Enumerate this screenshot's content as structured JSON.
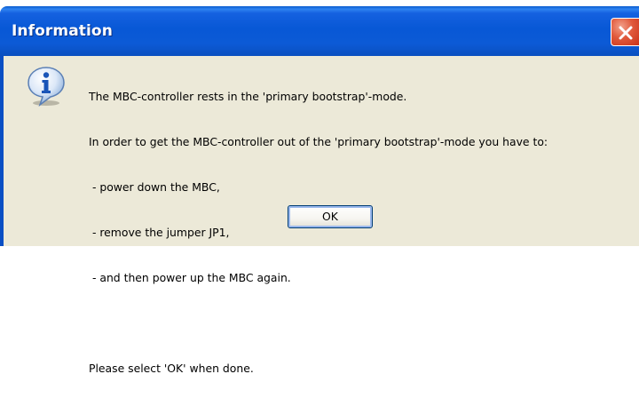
{
  "window": {
    "title": "Information",
    "icon": "information-icon",
    "close_icon": "close-icon"
  },
  "message": {
    "lines": [
      "The MBC-controller rests in the 'primary bootstrap'-mode.",
      "In order to get the MBC-controller out of the 'primary bootstrap'-mode you have to:",
      " - power down the MBC,",
      " - remove the jumper JP1,",
      " - and then power up the MBC again.",
      "",
      "Please select 'OK' when done."
    ]
  },
  "buttons": {
    "ok_label": "OK"
  },
  "colors": {
    "titlebar": "#0858d6",
    "client_background": "#ece9d8",
    "close_button": "#e0593b"
  }
}
